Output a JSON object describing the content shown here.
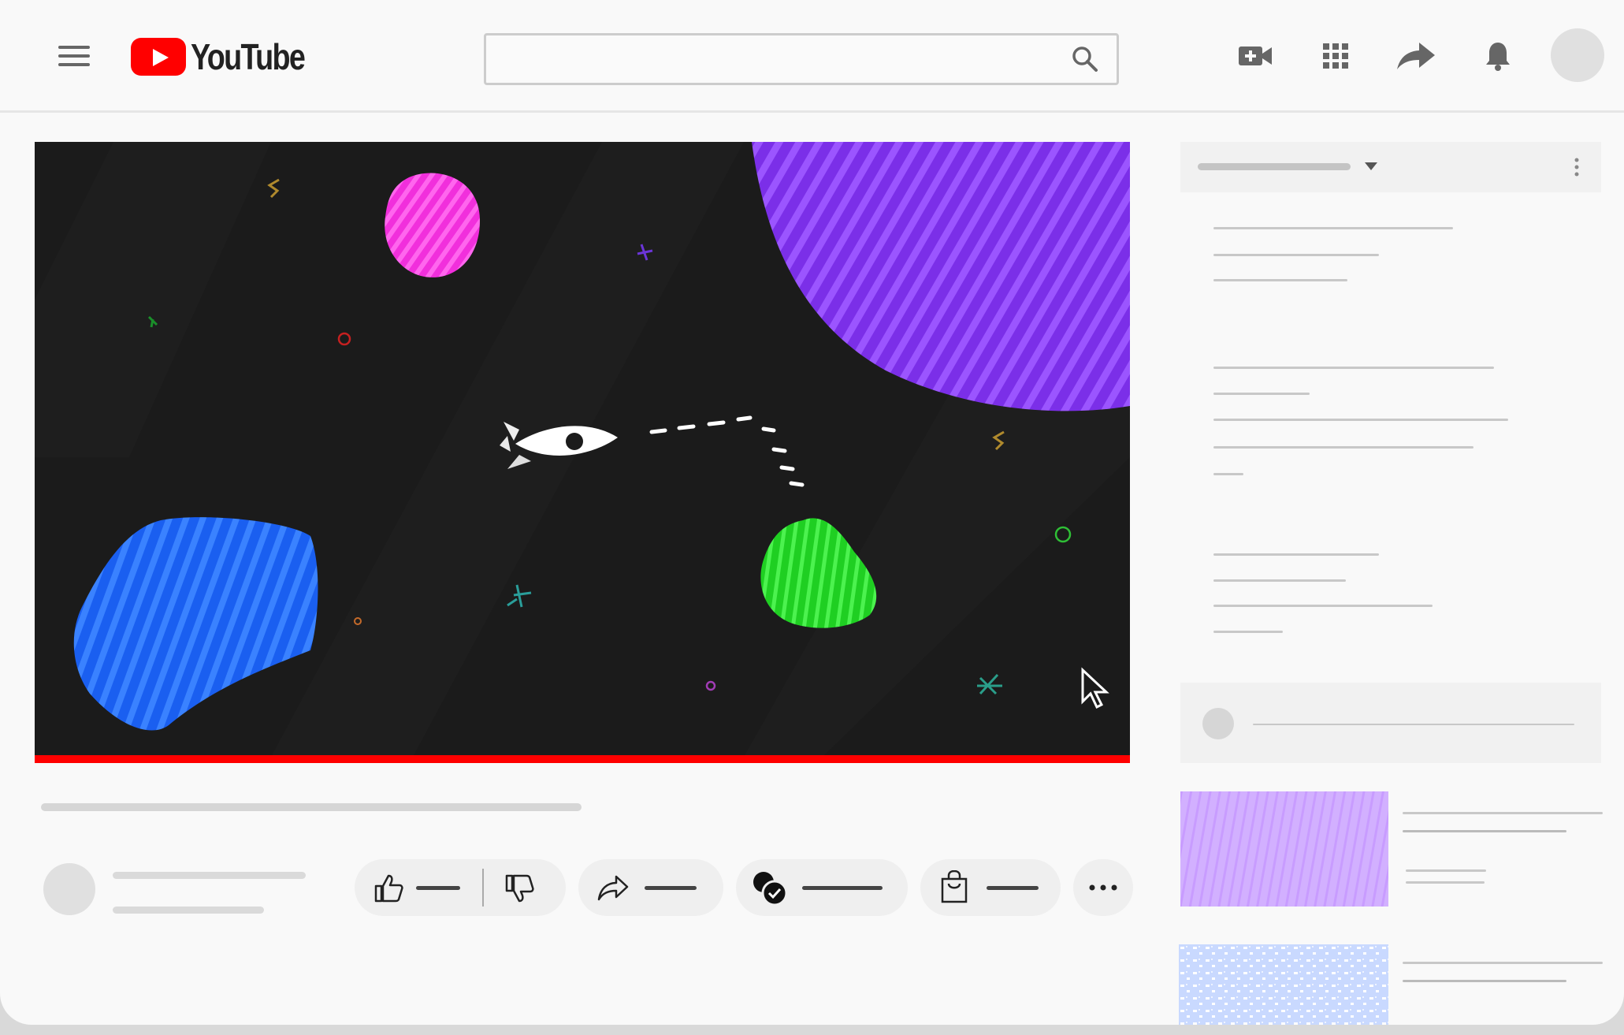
{
  "header": {
    "logo_text": "YouTube",
    "search_placeholder": ""
  },
  "colors": {
    "brand_red": "#ff0000",
    "planet_purple": "#9146ff",
    "planet_pink": "#ff44e8",
    "planet_blue": "#1f6cff",
    "planet_green": "#29e02c",
    "thumb_purple": "#d7b6ff",
    "thumb_blue": "#cfe0ff"
  },
  "icons": {
    "menu": "hamburger-icon",
    "search": "search-icon",
    "create": "video-camera-plus-icon",
    "apps": "grid-icon",
    "share": "share-arrow-icon",
    "notifications": "bell-icon",
    "like": "thumbs-up-icon",
    "dislike": "thumbs-down-icon",
    "share_action": "share-icon",
    "subscribe": "verified-check-icon",
    "shop": "shopping-bag-icon",
    "more": "more-horizontal-icon"
  },
  "player": {
    "progress_fraction": 1.0
  }
}
